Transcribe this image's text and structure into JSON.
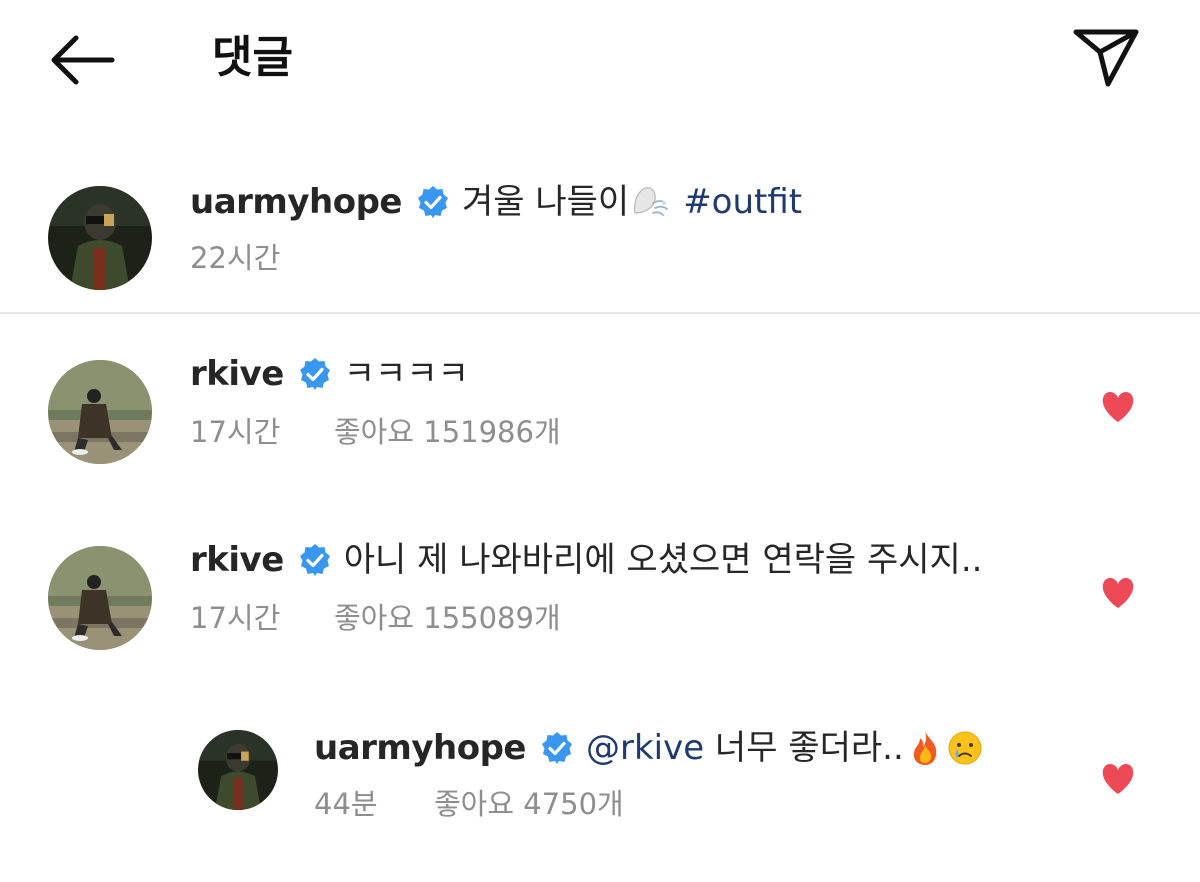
{
  "header": {
    "title": "댓글",
    "back_icon": "arrow-left-icon",
    "share_icon": "paper-plane-icon"
  },
  "post": {
    "username": "uarmyhope",
    "verified": true,
    "text": "겨울 나들이",
    "emoji": "wind-face",
    "hashtag": "#outfit",
    "time": "22시간"
  },
  "comments": [
    {
      "username": "rkive",
      "verified": true,
      "text": "ㅋㅋㅋㅋ",
      "time": "17시간",
      "likes": "좋아요 151986개",
      "liked": true
    },
    {
      "username": "rkive",
      "verified": true,
      "text": "아니 제 나와바리에 오셨으면 연락을 주시지..",
      "time": "17시간",
      "likes": "좋아요 155089개",
      "liked": true
    }
  ],
  "reply": {
    "username": "uarmyhope",
    "verified": true,
    "mention": "@rkive",
    "text": " 너무 좋더라..",
    "emojis": [
      "fire",
      "crying-face"
    ],
    "time": "44분",
    "likes": "좋아요 4750개",
    "liked": true
  },
  "colors": {
    "verified_blue": "#3897f0",
    "heart_red": "#ed4956",
    "link_blue": "#1e3a6e",
    "meta_gray": "#8e8e8e"
  }
}
